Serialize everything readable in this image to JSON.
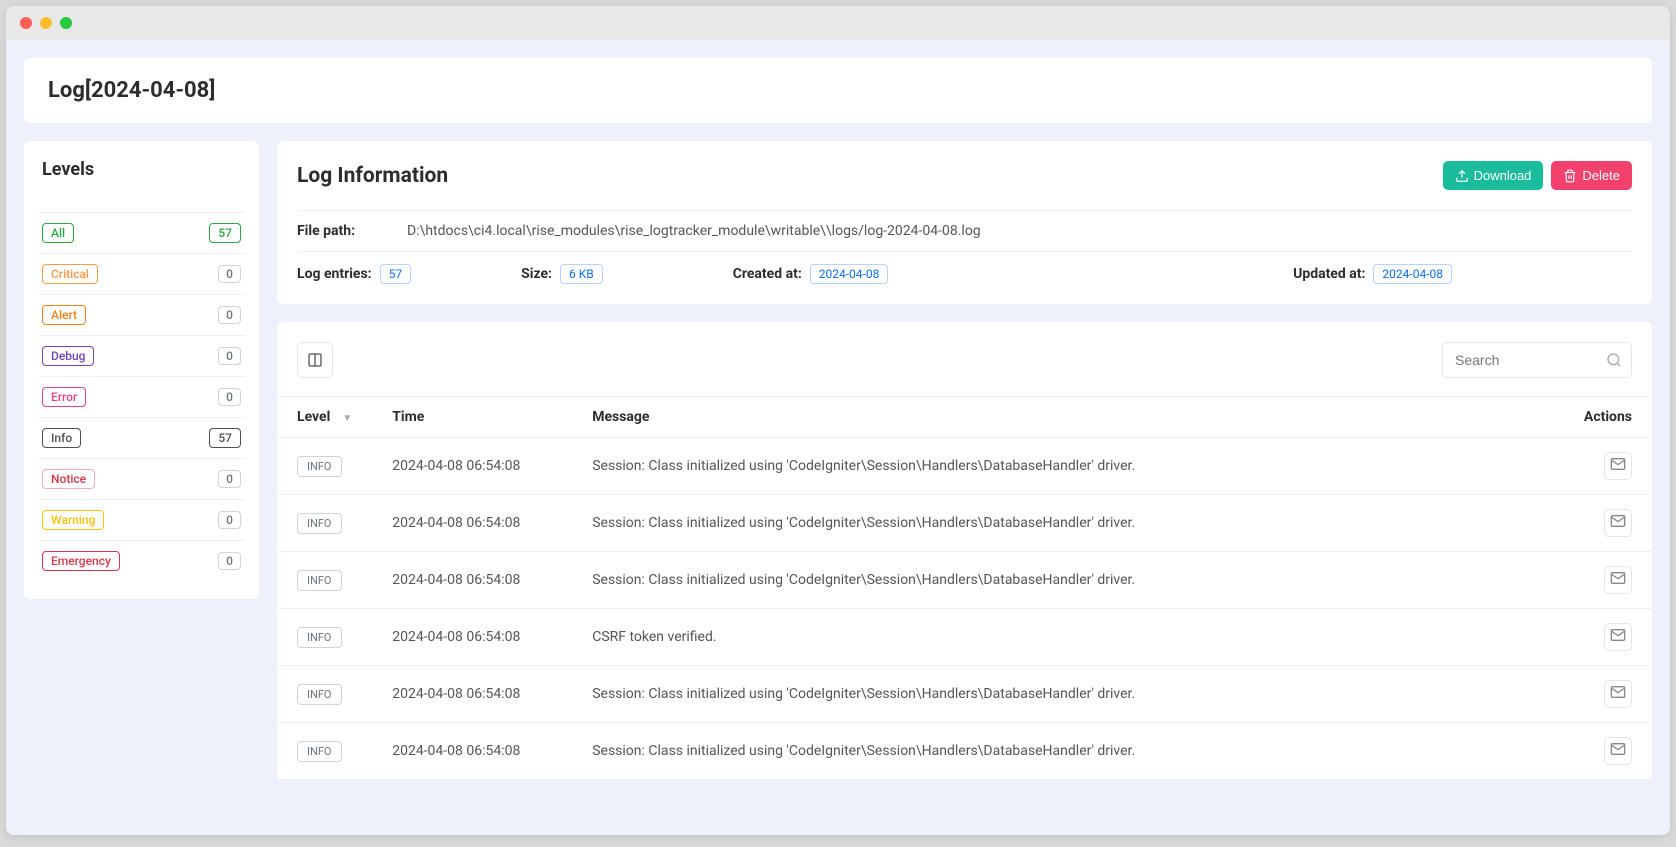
{
  "page_title": "Log[2024-04-08]",
  "sidebar": {
    "title": "Levels",
    "items": [
      {
        "label": "All",
        "cls": "badge-all",
        "count": "57",
        "count_cls": "badge-count-g"
      },
      {
        "label": "Critical",
        "cls": "badge-critical",
        "count": "0",
        "count_cls": "badge-count"
      },
      {
        "label": "Alert",
        "cls": "badge-alert",
        "count": "0",
        "count_cls": "badge-count"
      },
      {
        "label": "Debug",
        "cls": "badge-debug",
        "count": "0",
        "count_cls": "badge-count"
      },
      {
        "label": "Error",
        "cls": "badge-error",
        "count": "0",
        "count_cls": "badge-count"
      },
      {
        "label": "Info",
        "cls": "badge-info",
        "count": "57",
        "count_cls": "badge-count-info"
      },
      {
        "label": "Notice",
        "cls": "badge-notice",
        "count": "0",
        "count_cls": "badge-count"
      },
      {
        "label": "Warning",
        "cls": "badge-warning",
        "count": "0",
        "count_cls": "badge-count"
      },
      {
        "label": "Emergency",
        "cls": "badge-emergency",
        "count": "0",
        "count_cls": "badge-count"
      }
    ]
  },
  "info_card": {
    "title": "Log Information",
    "download_label": "Download",
    "delete_label": "Delete",
    "file_path_label": "File path:",
    "file_path": "D:\\htdocs\\ci4.local\\rise_modules\\rise_logtracker_module\\writable\\\\logs/log-2024-04-08.log",
    "entries_label": "Log entries:",
    "entries": "57",
    "size_label": "Size:",
    "size": "6 KB",
    "created_label": "Created at:",
    "created": "2024-04-08",
    "updated_label": "Updated at:",
    "updated": "2024-04-08"
  },
  "table": {
    "search_placeholder": "Search",
    "col_level": "Level",
    "col_time": "Time",
    "col_message": "Message",
    "col_actions": "Actions",
    "rows": [
      {
        "level": "INFO",
        "time": "2024-04-08 06:54:08",
        "msg": "Session: Class initialized using 'CodeIgniter\\Session\\Handlers\\DatabaseHandler' driver."
      },
      {
        "level": "INFO",
        "time": "2024-04-08 06:54:08",
        "msg": "Session: Class initialized using 'CodeIgniter\\Session\\Handlers\\DatabaseHandler' driver."
      },
      {
        "level": "INFO",
        "time": "2024-04-08 06:54:08",
        "msg": "Session: Class initialized using 'CodeIgniter\\Session\\Handlers\\DatabaseHandler' driver."
      },
      {
        "level": "INFO",
        "time": "2024-04-08 06:54:08",
        "msg": "CSRF token verified."
      },
      {
        "level": "INFO",
        "time": "2024-04-08 06:54:08",
        "msg": "Session: Class initialized using 'CodeIgniter\\Session\\Handlers\\DatabaseHandler' driver."
      },
      {
        "level": "INFO",
        "time": "2024-04-08 06:54:08",
        "msg": "Session: Class initialized using 'CodeIgniter\\Session\\Handlers\\DatabaseHandler' driver."
      }
    ]
  }
}
